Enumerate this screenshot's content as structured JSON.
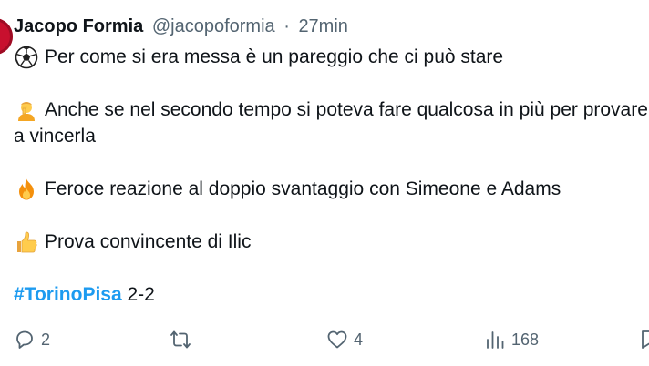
{
  "tweet": {
    "author_name": "Jacopo Formia",
    "handle": "@jacopoformia",
    "separator": "·",
    "time": "27min",
    "lines": {
      "l1": "Per come si era messa è un pareggio che ci può stare",
      "l2": "Anche se nel secondo tempo si poteva fare qualcosa in più per provare",
      "l3": "a vincerla",
      "l4": "Feroce reazione al doppio svantaggio con Simeone e Adams",
      "l5": "Prova convincente di Ilic",
      "hashtag": "#TorinoPisa",
      "score": " 2-2"
    },
    "emoji_icons": [
      "soccer-ball-icon",
      "person-facepalm-icon",
      "fire-icon",
      "thumbs-up-icon"
    ]
  },
  "actions": {
    "replies": "2",
    "retweets": "",
    "likes": "4",
    "views": "168"
  },
  "colors": {
    "text": "#0f1419",
    "muted": "#536471",
    "hashtag": "#1d9bf0",
    "avatar": "#c8102e"
  }
}
